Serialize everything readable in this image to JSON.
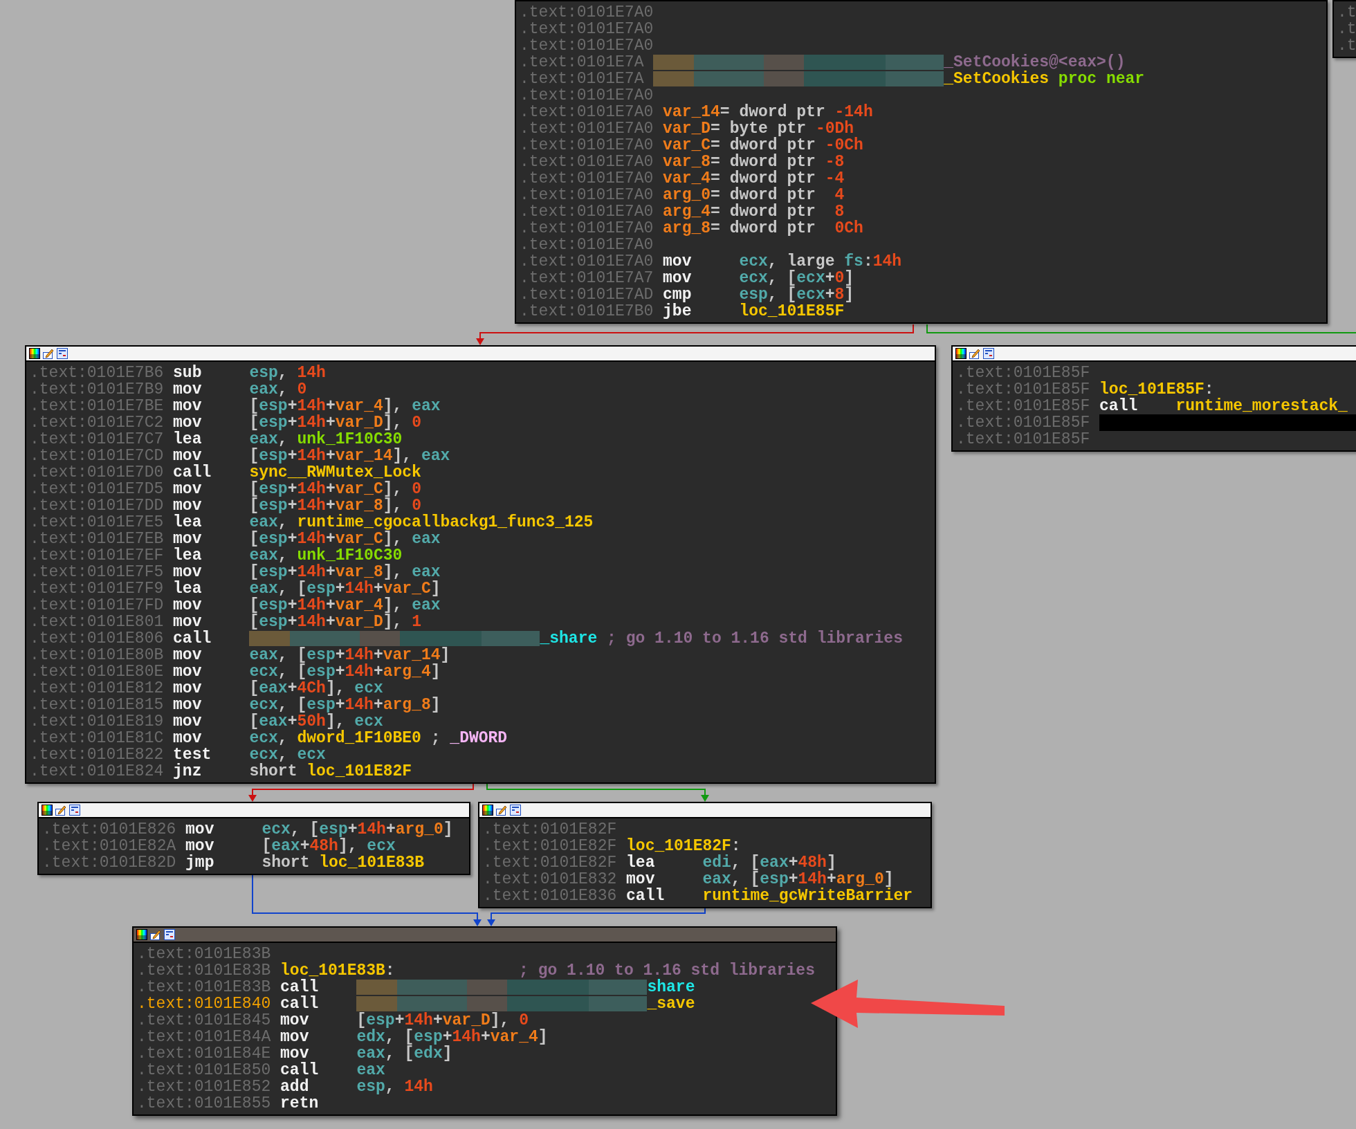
{
  "blocks": [
    {
      "header": false,
      "lines": [
        {
          "address": ".text:0101E7A0",
          "current": false
        },
        {
          "address": ".text:0101E7A0",
          "current": false
        },
        {
          "address": ".text:0101E7A0",
          "current": false
        },
        {
          "address": ".text:0101E7A",
          "current": false,
          "tokens": [
            {
              "kind": "blur"
            },
            {
              "kind": "cm",
              "text": "_SetCookies@<eax>()"
            }
          ]
        },
        {
          "address": ".text:0101E7A",
          "current": false,
          "tokens": [
            {
              "kind": "blur"
            },
            {
              "kind": "nm",
              "text": "_SetCookies"
            },
            {
              "kind": "grn",
              "text": " proc near"
            }
          ]
        },
        {
          "address": ".text:0101E7A0",
          "current": false
        },
        {
          "address": ".text:0101E7A0",
          "current": false,
          "tokens": [
            {
              "kind": "var",
              "text": "var_14"
            },
            {
              "kind": "p",
              "text": "= dword ptr "
            },
            {
              "kind": "num",
              "text": "-14h"
            }
          ]
        },
        {
          "address": ".text:0101E7A0",
          "current": false,
          "tokens": [
            {
              "kind": "var",
              "text": "var_D"
            },
            {
              "kind": "p",
              "text": "= byte ptr "
            },
            {
              "kind": "num",
              "text": "-0Dh"
            }
          ]
        },
        {
          "address": ".text:0101E7A0",
          "current": false,
          "tokens": [
            {
              "kind": "var",
              "text": "var_C"
            },
            {
              "kind": "p",
              "text": "= dword ptr "
            },
            {
              "kind": "num",
              "text": "-0Ch"
            }
          ]
        },
        {
          "address": ".text:0101E7A0",
          "current": false,
          "tokens": [
            {
              "kind": "var",
              "text": "var_8"
            },
            {
              "kind": "p",
              "text": "= dword ptr "
            },
            {
              "kind": "num",
              "text": "-8"
            }
          ]
        },
        {
          "address": ".text:0101E7A0",
          "current": false,
          "tokens": [
            {
              "kind": "var",
              "text": "var_4"
            },
            {
              "kind": "p",
              "text": "= dword ptr "
            },
            {
              "kind": "num",
              "text": "-4"
            }
          ]
        },
        {
          "address": ".text:0101E7A0",
          "current": false,
          "tokens": [
            {
              "kind": "var",
              "text": "arg_0"
            },
            {
              "kind": "p",
              "text": "= dword ptr  "
            },
            {
              "kind": "num",
              "text": "4"
            }
          ]
        },
        {
          "address": ".text:0101E7A0",
          "current": false,
          "tokens": [
            {
              "kind": "var",
              "text": "arg_4"
            },
            {
              "kind": "p",
              "text": "= dword ptr  "
            },
            {
              "kind": "num",
              "text": "8"
            }
          ]
        },
        {
          "address": ".text:0101E7A0",
          "current": false,
          "tokens": [
            {
              "kind": "var",
              "text": "arg_8"
            },
            {
              "kind": "p",
              "text": "= dword ptr  "
            },
            {
              "kind": "num",
              "text": "0Ch"
            }
          ]
        },
        {
          "address": ".text:0101E7A0",
          "current": false
        },
        {
          "address": ".text:0101E7A0",
          "current": false,
          "tokens": [
            {
              "kind": "mn",
              "text": "mov"
            },
            {
              "kind": "reg",
              "text": "ecx"
            },
            {
              "kind": "p",
              "text": ", large "
            },
            {
              "kind": "reg",
              "text": "fs"
            },
            {
              "kind": "p",
              "text": ":"
            },
            {
              "kind": "num",
              "text": "14h"
            }
          ]
        },
        {
          "address": ".text:0101E7A7",
          "current": false,
          "tokens": [
            {
              "kind": "mn",
              "text": "mov"
            },
            {
              "kind": "reg",
              "text": "ecx"
            },
            {
              "kind": "p",
              "text": ", ["
            },
            {
              "kind": "reg",
              "text": "ecx"
            },
            {
              "kind": "p",
              "text": "+"
            },
            {
              "kind": "num",
              "text": "0"
            },
            {
              "kind": "p",
              "text": "]"
            }
          ]
        },
        {
          "address": ".text:0101E7AD",
          "current": false,
          "tokens": [
            {
              "kind": "mn",
              "text": "cmp"
            },
            {
              "kind": "reg",
              "text": "esp"
            },
            {
              "kind": "p",
              "text": ", ["
            },
            {
              "kind": "reg",
              "text": "ecx"
            },
            {
              "kind": "p",
              "text": "+"
            },
            {
              "kind": "num",
              "text": "8"
            },
            {
              "kind": "p",
              "text": "]"
            }
          ]
        },
        {
          "address": ".text:0101E7B0",
          "current": false,
          "tokens": [
            {
              "kind": "mn",
              "text": "jbe"
            },
            {
              "kind": "nm",
              "text": "loc_101E85F"
            }
          ]
        }
      ]
    },
    {
      "header": false,
      "lines": [
        {
          "address": ".t",
          "current": false
        },
        {
          "address": ".t",
          "current": false
        },
        {
          "address": ".t",
          "current": false
        }
      ]
    },
    {
      "header": true,
      "selected": false,
      "lines": [
        {
          "address": ".text:0101E7B6",
          "current": false,
          "tokens": [
            {
              "kind": "mn",
              "text": "sub"
            },
            {
              "kind": "reg",
              "text": "esp"
            },
            {
              "kind": "p",
              "text": ", "
            },
            {
              "kind": "num",
              "text": "14h"
            }
          ]
        },
        {
          "address": ".text:0101E7B9",
          "current": false,
          "tokens": [
            {
              "kind": "mn",
              "text": "mov"
            },
            {
              "kind": "reg",
              "text": "eax"
            },
            {
              "kind": "p",
              "text": ", "
            },
            {
              "kind": "num",
              "text": "0"
            }
          ]
        },
        {
          "address": ".text:0101E7BE",
          "current": false,
          "tokens": [
            {
              "kind": "mn",
              "text": "mov"
            },
            {
              "kind": "p",
              "text": "["
            },
            {
              "kind": "reg",
              "text": "esp"
            },
            {
              "kind": "p",
              "text": "+"
            },
            {
              "kind": "num",
              "text": "14h"
            },
            {
              "kind": "p",
              "text": "+"
            },
            {
              "kind": "var",
              "text": "var_4"
            },
            {
              "kind": "p",
              "text": "], "
            },
            {
              "kind": "reg",
              "text": "eax"
            }
          ]
        },
        {
          "address": ".text:0101E7C2",
          "current": false,
          "tokens": [
            {
              "kind": "mn",
              "text": "mov"
            },
            {
              "kind": "p",
              "text": "["
            },
            {
              "kind": "reg",
              "text": "esp"
            },
            {
              "kind": "p",
              "text": "+"
            },
            {
              "kind": "num",
              "text": "14h"
            },
            {
              "kind": "p",
              "text": "+"
            },
            {
              "kind": "var",
              "text": "var_D"
            },
            {
              "kind": "p",
              "text": "], "
            },
            {
              "kind": "num",
              "text": "0"
            }
          ]
        },
        {
          "address": ".text:0101E7C7",
          "current": false,
          "tokens": [
            {
              "kind": "mn",
              "text": "lea"
            },
            {
              "kind": "reg",
              "text": "eax"
            },
            {
              "kind": "p",
              "text": ", "
            },
            {
              "kind": "grn",
              "text": "unk_1F10C30"
            }
          ]
        },
        {
          "address": ".text:0101E7CD",
          "current": false,
          "tokens": [
            {
              "kind": "mn",
              "text": "mov"
            },
            {
              "kind": "p",
              "text": "["
            },
            {
              "kind": "reg",
              "text": "esp"
            },
            {
              "kind": "p",
              "text": "+"
            },
            {
              "kind": "num",
              "text": "14h"
            },
            {
              "kind": "p",
              "text": "+"
            },
            {
              "kind": "var",
              "text": "var_14"
            },
            {
              "kind": "p",
              "text": "], "
            },
            {
              "kind": "reg",
              "text": "eax"
            }
          ]
        },
        {
          "address": ".text:0101E7D0",
          "current": false,
          "tokens": [
            {
              "kind": "mn",
              "text": "call"
            },
            {
              "kind": "nm",
              "text": "sync__RWMutex_Lock"
            }
          ]
        },
        {
          "address": ".text:0101E7D5",
          "current": false,
          "tokens": [
            {
              "kind": "mn",
              "text": "mov"
            },
            {
              "kind": "p",
              "text": "["
            },
            {
              "kind": "reg",
              "text": "esp"
            },
            {
              "kind": "p",
              "text": "+"
            },
            {
              "kind": "num",
              "text": "14h"
            },
            {
              "kind": "p",
              "text": "+"
            },
            {
              "kind": "var",
              "text": "var_C"
            },
            {
              "kind": "p",
              "text": "], "
            },
            {
              "kind": "num",
              "text": "0"
            }
          ]
        },
        {
          "address": ".text:0101E7DD",
          "current": false,
          "tokens": [
            {
              "kind": "mn",
              "text": "mov"
            },
            {
              "kind": "p",
              "text": "["
            },
            {
              "kind": "reg",
              "text": "esp"
            },
            {
              "kind": "p",
              "text": "+"
            },
            {
              "kind": "num",
              "text": "14h"
            },
            {
              "kind": "p",
              "text": "+"
            },
            {
              "kind": "var",
              "text": "var_8"
            },
            {
              "kind": "p",
              "text": "], "
            },
            {
              "kind": "num",
              "text": "0"
            }
          ]
        },
        {
          "address": ".text:0101E7E5",
          "current": false,
          "tokens": [
            {
              "kind": "mn",
              "text": "lea"
            },
            {
              "kind": "reg",
              "text": "eax"
            },
            {
              "kind": "p",
              "text": ", "
            },
            {
              "kind": "nm",
              "text": "runtime_cgocallbackg1_func3_125"
            }
          ]
        },
        {
          "address": ".text:0101E7EB",
          "current": false,
          "tokens": [
            {
              "kind": "mn",
              "text": "mov"
            },
            {
              "kind": "p",
              "text": "["
            },
            {
              "kind": "reg",
              "text": "esp"
            },
            {
              "kind": "p",
              "text": "+"
            },
            {
              "kind": "num",
              "text": "14h"
            },
            {
              "kind": "p",
              "text": "+"
            },
            {
              "kind": "var",
              "text": "var_C"
            },
            {
              "kind": "p",
              "text": "], "
            },
            {
              "kind": "reg",
              "text": "eax"
            }
          ]
        },
        {
          "address": ".text:0101E7EF",
          "current": false,
          "tokens": [
            {
              "kind": "mn",
              "text": "lea"
            },
            {
              "kind": "reg",
              "text": "eax"
            },
            {
              "kind": "p",
              "text": ", "
            },
            {
              "kind": "grn",
              "text": "unk_1F10C30"
            }
          ]
        },
        {
          "address": ".text:0101E7F5",
          "current": false,
          "tokens": [
            {
              "kind": "mn",
              "text": "mov"
            },
            {
              "kind": "p",
              "text": "["
            },
            {
              "kind": "reg",
              "text": "esp"
            },
            {
              "kind": "p",
              "text": "+"
            },
            {
              "kind": "num",
              "text": "14h"
            },
            {
              "kind": "p",
              "text": "+"
            },
            {
              "kind": "var",
              "text": "var_8"
            },
            {
              "kind": "p",
              "text": "], "
            },
            {
              "kind": "reg",
              "text": "eax"
            }
          ]
        },
        {
          "address": ".text:0101E7F9",
          "current": false,
          "tokens": [
            {
              "kind": "mn",
              "text": "lea"
            },
            {
              "kind": "reg",
              "text": "eax"
            },
            {
              "kind": "p",
              "text": ", ["
            },
            {
              "kind": "reg",
              "text": "esp"
            },
            {
              "kind": "p",
              "text": "+"
            },
            {
              "kind": "num",
              "text": "14h"
            },
            {
              "kind": "p",
              "text": "+"
            },
            {
              "kind": "var",
              "text": "var_C"
            },
            {
              "kind": "p",
              "text": "]"
            }
          ]
        },
        {
          "address": ".text:0101E7FD",
          "current": false,
          "tokens": [
            {
              "kind": "mn",
              "text": "mov"
            },
            {
              "kind": "p",
              "text": "["
            },
            {
              "kind": "reg",
              "text": "esp"
            },
            {
              "kind": "p",
              "text": "+"
            },
            {
              "kind": "num",
              "text": "14h"
            },
            {
              "kind": "p",
              "text": "+"
            },
            {
              "kind": "var",
              "text": "var_4"
            },
            {
              "kind": "p",
              "text": "], "
            },
            {
              "kind": "reg",
              "text": "eax"
            }
          ]
        },
        {
          "address": ".text:0101E801",
          "current": false,
          "tokens": [
            {
              "kind": "mn",
              "text": "mov"
            },
            {
              "kind": "p",
              "text": "["
            },
            {
              "kind": "reg",
              "text": "esp"
            },
            {
              "kind": "p",
              "text": "+"
            },
            {
              "kind": "num",
              "text": "14h"
            },
            {
              "kind": "p",
              "text": "+"
            },
            {
              "kind": "var",
              "text": "var_D"
            },
            {
              "kind": "p",
              "text": "], "
            },
            {
              "kind": "num",
              "text": "1"
            }
          ]
        },
        {
          "address": ".text:0101E806",
          "current": false,
          "tokens": [
            {
              "kind": "mn",
              "text": "call"
            },
            {
              "kind": "blur"
            },
            {
              "kind": "cy",
              "text": "_share"
            },
            {
              "kind": "cm",
              "text": " ; go 1.10 to 1.16 std libraries"
            }
          ]
        },
        {
          "address": ".text:0101E80B",
          "current": false,
          "tokens": [
            {
              "kind": "mn",
              "text": "mov"
            },
            {
              "kind": "reg",
              "text": "eax"
            },
            {
              "kind": "p",
              "text": ", ["
            },
            {
              "kind": "reg",
              "text": "esp"
            },
            {
              "kind": "p",
              "text": "+"
            },
            {
              "kind": "num",
              "text": "14h"
            },
            {
              "kind": "p",
              "text": "+"
            },
            {
              "kind": "var",
              "text": "var_14"
            },
            {
              "kind": "p",
              "text": "]"
            }
          ]
        },
        {
          "address": ".text:0101E80E",
          "current": false,
          "tokens": [
            {
              "kind": "mn",
              "text": "mov"
            },
            {
              "kind": "reg",
              "text": "ecx"
            },
            {
              "kind": "p",
              "text": ", ["
            },
            {
              "kind": "reg",
              "text": "esp"
            },
            {
              "kind": "p",
              "text": "+"
            },
            {
              "kind": "num",
              "text": "14h"
            },
            {
              "kind": "p",
              "text": "+"
            },
            {
              "kind": "var",
              "text": "arg_4"
            },
            {
              "kind": "p",
              "text": "]"
            }
          ]
        },
        {
          "address": ".text:0101E812",
          "current": false,
          "tokens": [
            {
              "kind": "mn",
              "text": "mov"
            },
            {
              "kind": "p",
              "text": "["
            },
            {
              "kind": "reg",
              "text": "eax"
            },
            {
              "kind": "p",
              "text": "+"
            },
            {
              "kind": "num",
              "text": "4Ch"
            },
            {
              "kind": "p",
              "text": "], "
            },
            {
              "kind": "reg",
              "text": "ecx"
            }
          ]
        },
        {
          "address": ".text:0101E815",
          "current": false,
          "tokens": [
            {
              "kind": "mn",
              "text": "mov"
            },
            {
              "kind": "reg",
              "text": "ecx"
            },
            {
              "kind": "p",
              "text": ", ["
            },
            {
              "kind": "reg",
              "text": "esp"
            },
            {
              "kind": "p",
              "text": "+"
            },
            {
              "kind": "num",
              "text": "14h"
            },
            {
              "kind": "p",
              "text": "+"
            },
            {
              "kind": "var",
              "text": "arg_8"
            },
            {
              "kind": "p",
              "text": "]"
            }
          ]
        },
        {
          "address": ".text:0101E819",
          "current": false,
          "tokens": [
            {
              "kind": "mn",
              "text": "mov"
            },
            {
              "kind": "p",
              "text": "["
            },
            {
              "kind": "reg",
              "text": "eax"
            },
            {
              "kind": "p",
              "text": "+"
            },
            {
              "kind": "num",
              "text": "50h"
            },
            {
              "kind": "p",
              "text": "], "
            },
            {
              "kind": "reg",
              "text": "ecx"
            }
          ]
        },
        {
          "address": ".text:0101E81C",
          "current": false,
          "tokens": [
            {
              "kind": "mn",
              "text": "mov"
            },
            {
              "kind": "reg",
              "text": "ecx"
            },
            {
              "kind": "p",
              "text": ", "
            },
            {
              "kind": "nm",
              "text": "dword_1F10BE0"
            },
            {
              "kind": "p",
              "text": " ; "
            },
            {
              "kind": "pk",
              "text": "_DWORD"
            }
          ]
        },
        {
          "address": ".text:0101E822",
          "current": false,
          "tokens": [
            {
              "kind": "mn",
              "text": "test"
            },
            {
              "kind": "reg",
              "text": "ecx"
            },
            {
              "kind": "p",
              "text": ", "
            },
            {
              "kind": "reg",
              "text": "ecx"
            }
          ]
        },
        {
          "address": ".text:0101E824",
          "current": false,
          "tokens": [
            {
              "kind": "mn",
              "text": "jnz"
            },
            {
              "kind": "p",
              "text": "short "
            },
            {
              "kind": "nm",
              "text": "loc_101E82F"
            }
          ]
        }
      ]
    },
    {
      "header": true,
      "selected": false,
      "lines": [
        {
          "address": ".text:0101E85F",
          "current": false
        },
        {
          "address": ".text:0101E85F",
          "current": false,
          "tokens": [
            {
              "kind": "nm",
              "text": "loc_101E85F"
            },
            {
              "kind": "p",
              "text": ":"
            }
          ]
        },
        {
          "address": ".text:0101E85F",
          "current": false,
          "tokens": [
            {
              "kind": "mn",
              "text": "call"
            },
            {
              "kind": "nm",
              "text": "runtime_morestack_"
            }
          ]
        },
        {
          "address": ".text:0101E85F",
          "current": false,
          "tokens": [
            {
              "kind": "black"
            }
          ]
        },
        {
          "address": ".text:0101E85F",
          "current": false
        }
      ]
    },
    {
      "header": true,
      "selected": false,
      "lines": [
        {
          "address": ".text:0101E826",
          "current": false,
          "tokens": [
            {
              "kind": "mn",
              "text": "mov"
            },
            {
              "kind": "reg",
              "text": "ecx"
            },
            {
              "kind": "p",
              "text": ", ["
            },
            {
              "kind": "reg",
              "text": "esp"
            },
            {
              "kind": "p",
              "text": "+"
            },
            {
              "kind": "num",
              "text": "14h"
            },
            {
              "kind": "p",
              "text": "+"
            },
            {
              "kind": "var",
              "text": "arg_0"
            },
            {
              "kind": "p",
              "text": "]"
            }
          ]
        },
        {
          "address": ".text:0101E82A",
          "current": false,
          "tokens": [
            {
              "kind": "mn",
              "text": "mov"
            },
            {
              "kind": "p",
              "text": "["
            },
            {
              "kind": "reg",
              "text": "eax"
            },
            {
              "kind": "p",
              "text": "+"
            },
            {
              "kind": "num",
              "text": "48h"
            },
            {
              "kind": "p",
              "text": "], "
            },
            {
              "kind": "reg",
              "text": "ecx"
            }
          ]
        },
        {
          "address": ".text:0101E82D",
          "current": false,
          "tokens": [
            {
              "kind": "mn",
              "text": "jmp"
            },
            {
              "kind": "p",
              "text": "short "
            },
            {
              "kind": "nm",
              "text": "loc_101E83B"
            }
          ]
        }
      ]
    },
    {
      "header": true,
      "selected": false,
      "lines": [
        {
          "address": ".text:0101E82F",
          "current": false
        },
        {
          "address": ".text:0101E82F",
          "current": false,
          "tokens": [
            {
              "kind": "nm",
              "text": "loc_101E82F"
            },
            {
              "kind": "p",
              "text": ":"
            }
          ]
        },
        {
          "address": ".text:0101E82F",
          "current": false,
          "tokens": [
            {
              "kind": "mn",
              "text": "lea"
            },
            {
              "kind": "reg",
              "text": "edi"
            },
            {
              "kind": "p",
              "text": ", ["
            },
            {
              "kind": "reg",
              "text": "eax"
            },
            {
              "kind": "p",
              "text": "+"
            },
            {
              "kind": "num",
              "text": "48h"
            },
            {
              "kind": "p",
              "text": "]"
            }
          ]
        },
        {
          "address": ".text:0101E832",
          "current": false,
          "tokens": [
            {
              "kind": "mn",
              "text": "mov"
            },
            {
              "kind": "reg",
              "text": "eax"
            },
            {
              "kind": "p",
              "text": ", ["
            },
            {
              "kind": "reg",
              "text": "esp"
            },
            {
              "kind": "p",
              "text": "+"
            },
            {
              "kind": "num",
              "text": "14h"
            },
            {
              "kind": "p",
              "text": "+"
            },
            {
              "kind": "var",
              "text": "arg_0"
            },
            {
              "kind": "p",
              "text": "]"
            }
          ]
        },
        {
          "address": ".text:0101E836",
          "current": false,
          "tokens": [
            {
              "kind": "mn",
              "text": "call"
            },
            {
              "kind": "nm",
              "text": "runtime_gcWriteBarrier"
            }
          ]
        }
      ]
    },
    {
      "header": true,
      "selected": true,
      "lines": [
        {
          "address": ".text:0101E83B",
          "current": false
        },
        {
          "address": ".text:0101E83B",
          "current": false,
          "tokens": [
            {
              "kind": "nm",
              "text": "loc_101E83B"
            },
            {
              "kind": "p",
              "text": ":             "
            },
            {
              "kind": "cm",
              "text": "; go 1.10 to 1.16 std libraries"
            }
          ]
        },
        {
          "address": ".text:0101E83B",
          "current": false,
          "tokens": [
            {
              "kind": "mn",
              "text": "call"
            },
            {
              "kind": "blur"
            },
            {
              "kind": "cy",
              "text": "share"
            }
          ]
        },
        {
          "address": ".text:0101E840",
          "current": true,
          "tokens": [
            {
              "kind": "mn",
              "text": "call"
            },
            {
              "kind": "blur"
            },
            {
              "kind": "nm",
              "text": "_save"
            }
          ]
        },
        {
          "address": ".text:0101E845",
          "current": false,
          "tokens": [
            {
              "kind": "mn",
              "text": "mov"
            },
            {
              "kind": "p",
              "text": "["
            },
            {
              "kind": "reg",
              "text": "esp"
            },
            {
              "kind": "p",
              "text": "+"
            },
            {
              "kind": "num",
              "text": "14h"
            },
            {
              "kind": "p",
              "text": "+"
            },
            {
              "kind": "var",
              "text": "var_D"
            },
            {
              "kind": "p",
              "text": "], "
            },
            {
              "kind": "num",
              "text": "0"
            }
          ]
        },
        {
          "address": ".text:0101E84A",
          "current": false,
          "tokens": [
            {
              "kind": "mn",
              "text": "mov"
            },
            {
              "kind": "reg",
              "text": "edx"
            },
            {
              "kind": "p",
              "text": ", ["
            },
            {
              "kind": "reg",
              "text": "esp"
            },
            {
              "kind": "p",
              "text": "+"
            },
            {
              "kind": "num",
              "text": "14h"
            },
            {
              "kind": "p",
              "text": "+"
            },
            {
              "kind": "var",
              "text": "var_4"
            },
            {
              "kind": "p",
              "text": "]"
            }
          ]
        },
        {
          "address": ".text:0101E84E",
          "current": false,
          "tokens": [
            {
              "kind": "mn",
              "text": "mov"
            },
            {
              "kind": "reg",
              "text": "eax"
            },
            {
              "kind": "p",
              "text": ", ["
            },
            {
              "kind": "reg",
              "text": "edx"
            },
            {
              "kind": "p",
              "text": "]"
            }
          ]
        },
        {
          "address": ".text:0101E850",
          "current": false,
          "tokens": [
            {
              "kind": "mn",
              "text": "call"
            },
            {
              "kind": "reg",
              "text": "eax"
            }
          ]
        },
        {
          "address": ".text:0101E852",
          "current": false,
          "tokens": [
            {
              "kind": "mn",
              "text": "add"
            },
            {
              "kind": "reg",
              "text": "esp"
            },
            {
              "kind": "p",
              "text": ", "
            },
            {
              "kind": "num",
              "text": "14h"
            }
          ]
        },
        {
          "address": ".text:0101E855",
          "current": false,
          "tokens": [
            {
              "kind": "mn",
              "text": "retn"
            }
          ]
        }
      ]
    }
  ],
  "edges": [
    {
      "color": "#cc1111"
    },
    {
      "color": "#119911"
    },
    {
      "color": "#cc1111"
    },
    {
      "color": "#119911"
    },
    {
      "color": "#1144cc"
    },
    {
      "color": "#1144cc"
    }
  ]
}
